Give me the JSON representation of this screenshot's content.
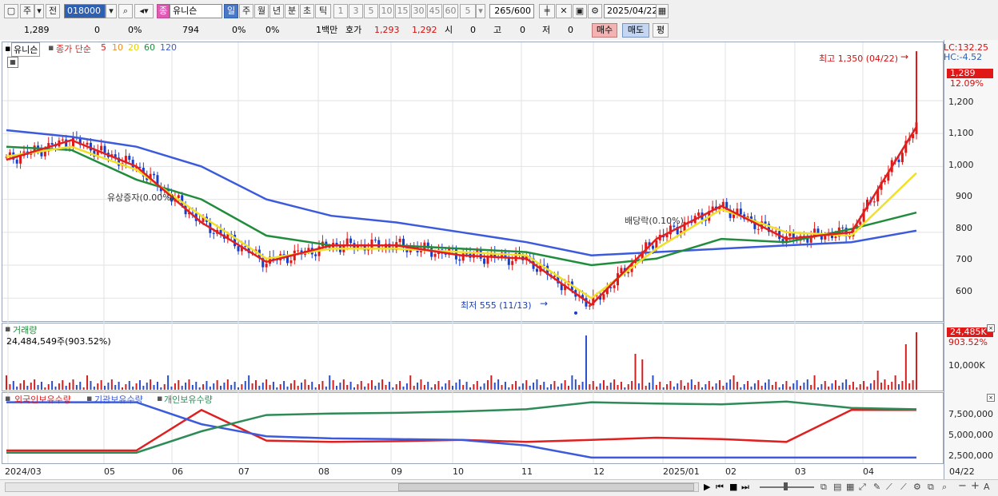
{
  "toolbar": {
    "market": "주",
    "prev": "전",
    "code": "018000",
    "name_badge": "종",
    "name": "유니슨",
    "periods": [
      "일",
      "주",
      "월",
      "년",
      "분",
      "초",
      "틱"
    ],
    "numbers": [
      "1",
      "3",
      "5",
      "10",
      "15",
      "30",
      "45",
      "60"
    ],
    "count_sel": "5",
    "range": "265/600",
    "date": "2025/04/22"
  },
  "quote": {
    "price": "1,289",
    "change": "0",
    "pct": "0%",
    "volume": "794",
    "v_pct1": "0%",
    "v_pct2": "0%",
    "unit": "1백만",
    "hoga_label": "호가",
    "ask": "1,293",
    "bid": "1,292",
    "si_label": "시",
    "si": "0",
    "go_label": "고",
    "go": "0",
    "jeo_label": "저",
    "jeo": "0",
    "buy": "매수",
    "sell": "매도",
    "pyeong": "평"
  },
  "price_panel": {
    "stock_name": "유니슨",
    "ma_title": "종가 단순",
    "ma_periods": [
      "5",
      "10",
      "20",
      "60",
      "120"
    ],
    "ma_colors": [
      "#e02020",
      "#f08c1e",
      "#f0e028",
      "#208c3c",
      "#3c5adc"
    ],
    "lc": "LC:132.25",
    "hc": "HC:-4.52",
    "last": "1,289",
    "last_pct": "12.09%",
    "high_note": "최고 1,350 (04/22)",
    "low_note": "최저 555 (11/13)",
    "event1": "유상증자(0.00%)",
    "event2": "배당락(0.10%)",
    "axis": [
      "1,200",
      "1,100",
      "1,000",
      "900",
      "800",
      "700",
      "600"
    ]
  },
  "volume_panel": {
    "title": "거래량",
    "value": "24,484,549주(903.52%)",
    "last": "24,485K",
    "last_pct": "903.52%",
    "axis": [
      "10,000K"
    ]
  },
  "holding_panel": {
    "series": [
      "외국인보유수량",
      "기관보유수량",
      "개인보유수량"
    ],
    "series_colors": [
      "#e02020",
      "#3c5adc",
      "#2e8b57"
    ],
    "axis": [
      "7,500,000",
      "5,000,000",
      "2,500,000"
    ]
  },
  "dates": [
    "2024/03",
    "05",
    "06",
    "07",
    "08",
    "09",
    "10",
    "11",
    "12",
    "2025/01",
    "02",
    "03",
    "04",
    "04/22"
  ],
  "chart_data": {
    "type": "line",
    "title": "",
    "x": [
      "2024/03",
      "05",
      "06",
      "07",
      "08",
      "09",
      "10",
      "11",
      "12",
      "2025/01",
      "02",
      "03",
      "04",
      "04/22"
    ],
    "series": [
      {
        "name": "5",
        "values": [
          1020,
          1080,
          1000,
          830,
          710,
          760,
          760,
          730,
          720,
          580,
          780,
          880,
          780,
          800,
          1120
        ]
      },
      {
        "name": "20",
        "values": [
          1030,
          1060,
          990,
          850,
          720,
          750,
          750,
          740,
          730,
          600,
          750,
          870,
          800,
          790,
          980
        ]
      },
      {
        "name": "60",
        "values": [
          1060,
          1050,
          960,
          900,
          790,
          760,
          760,
          750,
          740,
          700,
          720,
          780,
          770,
          810,
          860
        ]
      },
      {
        "name": "120",
        "values": [
          1110,
          1090,
          1060,
          1000,
          900,
          850,
          830,
          800,
          770,
          730,
          740,
          750,
          760,
          770,
          805
        ]
      }
    ],
    "ylim": [
      540,
      1360
    ],
    "ylabel": "",
    "high": 1350,
    "low": 555
  }
}
